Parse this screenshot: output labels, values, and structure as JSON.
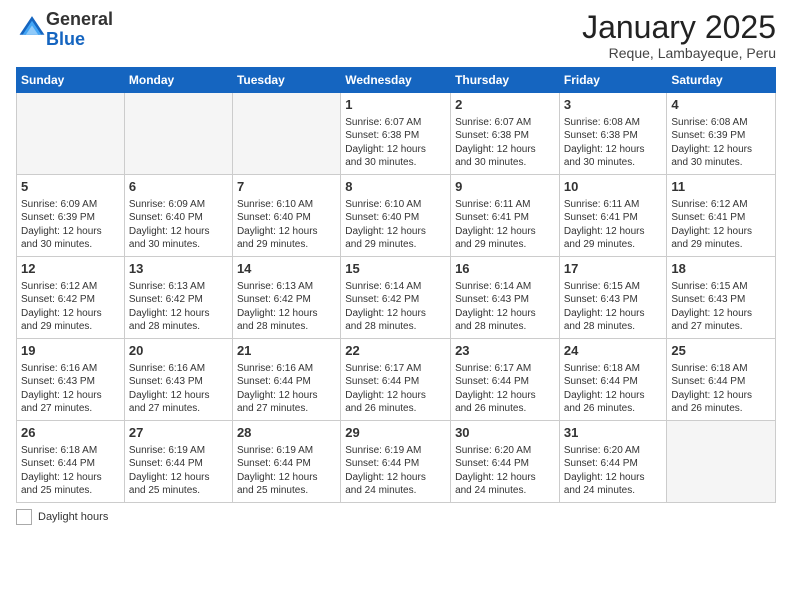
{
  "logo": {
    "general": "General",
    "blue": "Blue"
  },
  "title": "January 2025",
  "location": "Reque, Lambayeque, Peru",
  "days_of_week": [
    "Sunday",
    "Monday",
    "Tuesday",
    "Wednesday",
    "Thursday",
    "Friday",
    "Saturday"
  ],
  "weeks": [
    [
      {
        "day": "",
        "info": ""
      },
      {
        "day": "",
        "info": ""
      },
      {
        "day": "",
        "info": ""
      },
      {
        "day": "1",
        "info": "Sunrise: 6:07 AM\nSunset: 6:38 PM\nDaylight: 12 hours\nand 30 minutes."
      },
      {
        "day": "2",
        "info": "Sunrise: 6:07 AM\nSunset: 6:38 PM\nDaylight: 12 hours\nand 30 minutes."
      },
      {
        "day": "3",
        "info": "Sunrise: 6:08 AM\nSunset: 6:38 PM\nDaylight: 12 hours\nand 30 minutes."
      },
      {
        "day": "4",
        "info": "Sunrise: 6:08 AM\nSunset: 6:39 PM\nDaylight: 12 hours\nand 30 minutes."
      }
    ],
    [
      {
        "day": "5",
        "info": "Sunrise: 6:09 AM\nSunset: 6:39 PM\nDaylight: 12 hours\nand 30 minutes."
      },
      {
        "day": "6",
        "info": "Sunrise: 6:09 AM\nSunset: 6:40 PM\nDaylight: 12 hours\nand 30 minutes."
      },
      {
        "day": "7",
        "info": "Sunrise: 6:10 AM\nSunset: 6:40 PM\nDaylight: 12 hours\nand 29 minutes."
      },
      {
        "day": "8",
        "info": "Sunrise: 6:10 AM\nSunset: 6:40 PM\nDaylight: 12 hours\nand 29 minutes."
      },
      {
        "day": "9",
        "info": "Sunrise: 6:11 AM\nSunset: 6:41 PM\nDaylight: 12 hours\nand 29 minutes."
      },
      {
        "day": "10",
        "info": "Sunrise: 6:11 AM\nSunset: 6:41 PM\nDaylight: 12 hours\nand 29 minutes."
      },
      {
        "day": "11",
        "info": "Sunrise: 6:12 AM\nSunset: 6:41 PM\nDaylight: 12 hours\nand 29 minutes."
      }
    ],
    [
      {
        "day": "12",
        "info": "Sunrise: 6:12 AM\nSunset: 6:42 PM\nDaylight: 12 hours\nand 29 minutes."
      },
      {
        "day": "13",
        "info": "Sunrise: 6:13 AM\nSunset: 6:42 PM\nDaylight: 12 hours\nand 28 minutes."
      },
      {
        "day": "14",
        "info": "Sunrise: 6:13 AM\nSunset: 6:42 PM\nDaylight: 12 hours\nand 28 minutes."
      },
      {
        "day": "15",
        "info": "Sunrise: 6:14 AM\nSunset: 6:42 PM\nDaylight: 12 hours\nand 28 minutes."
      },
      {
        "day": "16",
        "info": "Sunrise: 6:14 AM\nSunset: 6:43 PM\nDaylight: 12 hours\nand 28 minutes."
      },
      {
        "day": "17",
        "info": "Sunrise: 6:15 AM\nSunset: 6:43 PM\nDaylight: 12 hours\nand 28 minutes."
      },
      {
        "day": "18",
        "info": "Sunrise: 6:15 AM\nSunset: 6:43 PM\nDaylight: 12 hours\nand 27 minutes."
      }
    ],
    [
      {
        "day": "19",
        "info": "Sunrise: 6:16 AM\nSunset: 6:43 PM\nDaylight: 12 hours\nand 27 minutes."
      },
      {
        "day": "20",
        "info": "Sunrise: 6:16 AM\nSunset: 6:43 PM\nDaylight: 12 hours\nand 27 minutes."
      },
      {
        "day": "21",
        "info": "Sunrise: 6:16 AM\nSunset: 6:44 PM\nDaylight: 12 hours\nand 27 minutes."
      },
      {
        "day": "22",
        "info": "Sunrise: 6:17 AM\nSunset: 6:44 PM\nDaylight: 12 hours\nand 26 minutes."
      },
      {
        "day": "23",
        "info": "Sunrise: 6:17 AM\nSunset: 6:44 PM\nDaylight: 12 hours\nand 26 minutes."
      },
      {
        "day": "24",
        "info": "Sunrise: 6:18 AM\nSunset: 6:44 PM\nDaylight: 12 hours\nand 26 minutes."
      },
      {
        "day": "25",
        "info": "Sunrise: 6:18 AM\nSunset: 6:44 PM\nDaylight: 12 hours\nand 26 minutes."
      }
    ],
    [
      {
        "day": "26",
        "info": "Sunrise: 6:18 AM\nSunset: 6:44 PM\nDaylight: 12 hours\nand 25 minutes."
      },
      {
        "day": "27",
        "info": "Sunrise: 6:19 AM\nSunset: 6:44 PM\nDaylight: 12 hours\nand 25 minutes."
      },
      {
        "day": "28",
        "info": "Sunrise: 6:19 AM\nSunset: 6:44 PM\nDaylight: 12 hours\nand 25 minutes."
      },
      {
        "day": "29",
        "info": "Sunrise: 6:19 AM\nSunset: 6:44 PM\nDaylight: 12 hours\nand 24 minutes."
      },
      {
        "day": "30",
        "info": "Sunrise: 6:20 AM\nSunset: 6:44 PM\nDaylight: 12 hours\nand 24 minutes."
      },
      {
        "day": "31",
        "info": "Sunrise: 6:20 AM\nSunset: 6:44 PM\nDaylight: 12 hours\nand 24 minutes."
      },
      {
        "day": "",
        "info": ""
      }
    ]
  ],
  "footer": {
    "daylight_label": "Daylight hours"
  }
}
